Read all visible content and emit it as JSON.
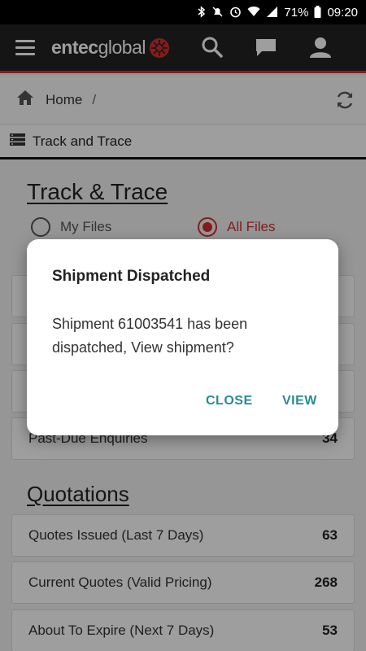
{
  "status_bar": {
    "battery": "71%",
    "time": "09:20"
  },
  "app_bar": {
    "logo_text_bold": "entec",
    "logo_text_light": "global",
    "icons": [
      "menu-icon",
      "search-icon",
      "chat-icon",
      "user-icon"
    ]
  },
  "breadcrumb": {
    "home": "Home",
    "separator": "/"
  },
  "section_header": {
    "label": "Track and Trace"
  },
  "track_trace": {
    "title": "Track & Trace",
    "radio_my_files": "My Files",
    "radio_all_files": "All Files",
    "selected": "All Files",
    "rows": [
      {
        "label": "Past-Due Enquiries",
        "value": "34"
      }
    ]
  },
  "quotations": {
    "title": "Quotations",
    "rows": [
      {
        "label": "Quotes Issued (Last 7 Days)",
        "value": "63"
      },
      {
        "label": "Current Quotes (Valid Pricing)",
        "value": "268"
      },
      {
        "label": "About To Expire (Next 7 Days)",
        "value": "53"
      }
    ]
  },
  "dialog": {
    "title": "Shipment Dispatched",
    "message": "Shipment 61003541 has been dispatched, View shipment?",
    "close_label": "CLOSE",
    "view_label": "VIEW"
  },
  "colors": {
    "accent_red": "#d32f2f",
    "dialog_button": "#2a8a95",
    "app_bar": "#222222"
  }
}
